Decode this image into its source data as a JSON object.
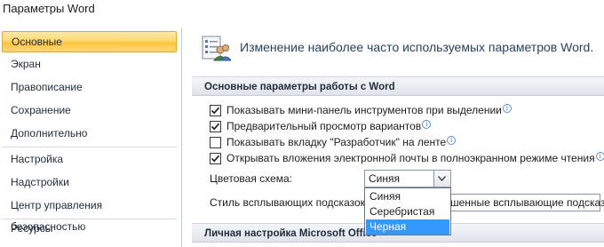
{
  "window": {
    "title": "Параметры Word"
  },
  "sidebar": {
    "items": [
      {
        "label": "Основные"
      },
      {
        "label": "Экран"
      },
      {
        "label": "Правописание"
      },
      {
        "label": "Сохранение"
      },
      {
        "label": "Дополнительно"
      },
      {
        "label": "Настройка"
      },
      {
        "label": "Надстройки"
      },
      {
        "label": "Центр управления безопасностью"
      },
      {
        "label": "Ресурсы"
      }
    ]
  },
  "content": {
    "heading": "Изменение наиболее часто используемых параметров Word.",
    "section1_title": "Основные параметры работы с Word",
    "options": [
      {
        "label": "Показывать мини-панель инструментов при выделении",
        "checked": true
      },
      {
        "label": "Предварительный просмотр вариантов",
        "checked": true
      },
      {
        "label": "Показывать вкладку \"Разработчик\" на ленте",
        "checked": false
      },
      {
        "label": "Открывать вложения электронной почты в полноэкранном режиме чтения",
        "checked": true
      }
    ],
    "color_scheme": {
      "label": "Цветовая схема:",
      "value": "Синяя",
      "options": [
        "Синяя",
        "Серебристая",
        "Черная"
      ],
      "highlighted": "Черная"
    },
    "tooltip_style": {
      "label": "Стиль всплывающих подсказок:",
      "value_partial": "шенные всплывающие подсказки"
    },
    "section2_title": "Личная настройка Microsoft Office"
  }
}
